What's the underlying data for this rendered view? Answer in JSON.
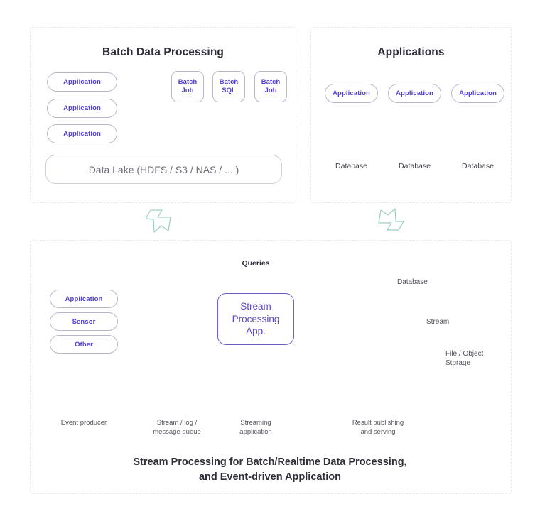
{
  "panels": {
    "batch": {
      "title": "Batch Data Processing"
    },
    "applications": {
      "title": "Applications"
    },
    "stream": {
      "caption_line1": "Stream Processing for Batch/Realtime Data Processing,",
      "caption_line2": "and Event-driven Application"
    }
  },
  "batch": {
    "sources": [
      {
        "label": "Application"
      },
      {
        "label": "Application"
      },
      {
        "label": "Application"
      }
    ],
    "jobs": [
      {
        "line1": "Batch",
        "line2": "Job"
      },
      {
        "line1": "Batch",
        "line2": "SQL"
      },
      {
        "line1": "Batch",
        "line2": "Job"
      }
    ],
    "storage": {
      "label": "Data Lake (HDFS / S3 / NAS / ... )"
    }
  },
  "applications": {
    "columns": [
      {
        "app_label": "Application",
        "db_label": "Database"
      },
      {
        "app_label": "Application",
        "db_label": "Database"
      },
      {
        "app_label": "Application",
        "db_label": "Database"
      }
    ]
  },
  "stream": {
    "producers": [
      {
        "label": "Application"
      },
      {
        "label": "Sensor"
      },
      {
        "label": "Other"
      }
    ],
    "queue": {
      "icon": "stream-bars-icon"
    },
    "queries_label": "Queries",
    "app_box": {
      "line1": "Stream",
      "line2": "Processing",
      "line3": "App."
    },
    "outputs": [
      {
        "label": "Database",
        "icon": "database-cylinder-icon"
      },
      {
        "label": "Stream",
        "icon": "stream-bars-icon"
      },
      {
        "label": "File / Object",
        "label2": "Storage",
        "icon": "server-storage-icon"
      }
    ],
    "timeline": [
      {
        "line1": "Event producer",
        "line2": ""
      },
      {
        "line1": "Stream / log /",
        "line2": "message queue"
      },
      {
        "line1": "Streaming",
        "line2": "application"
      },
      {
        "line1": "Result publishing",
        "line2": "and serving"
      }
    ]
  },
  "colors": {
    "purple": "#6b5ce7",
    "purple_dark": "#4f3fd6",
    "purple_light": "#b3a6e8",
    "teal": "#5cc0a8",
    "teal_dark": "#3aa98e",
    "panel_border": "#e8e8ee",
    "box_border": "#b9b7cc",
    "text_gray": "#55555f"
  }
}
